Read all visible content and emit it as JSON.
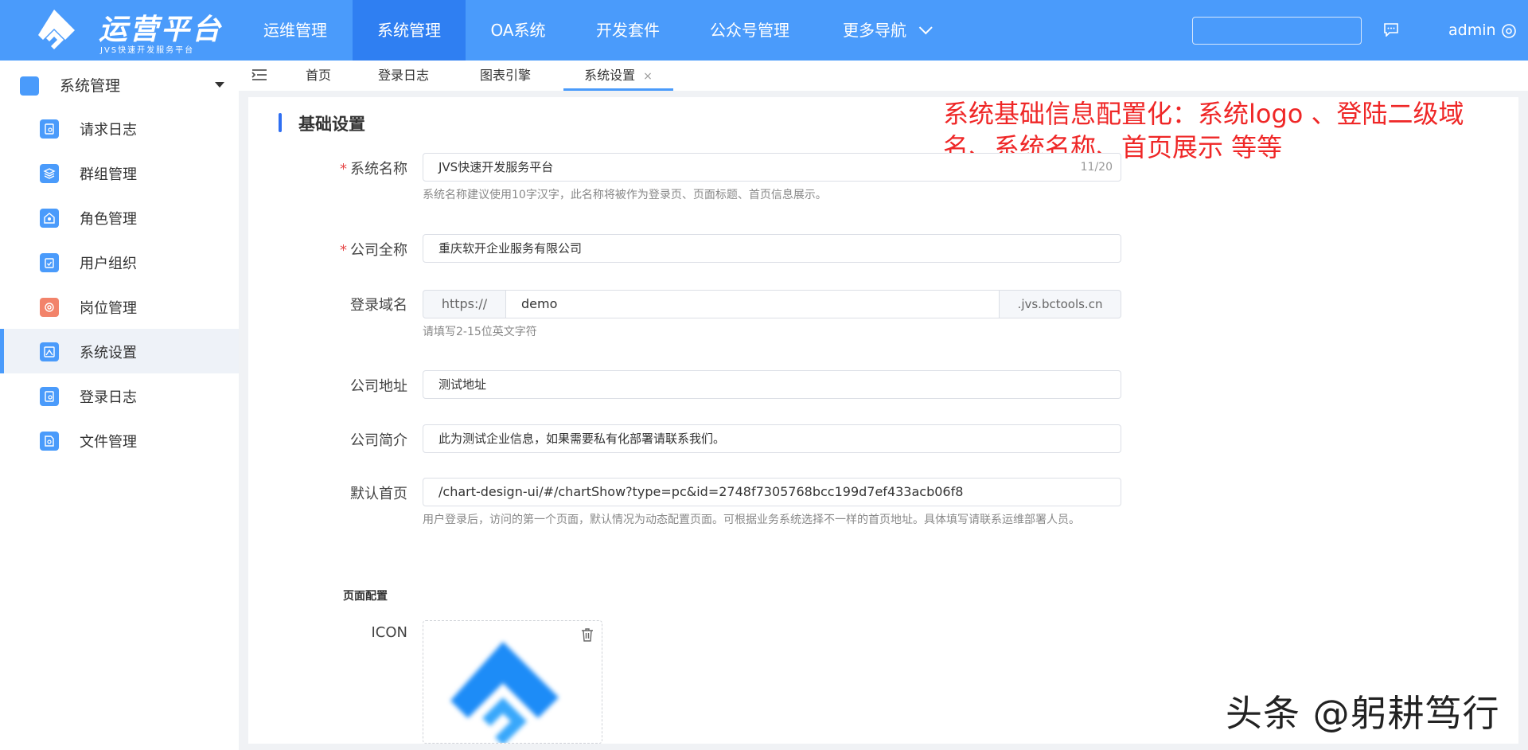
{
  "header": {
    "logo_title": "运营平台",
    "logo_subtitle": "JVS快速开发服务平台",
    "nav": [
      {
        "label": "运维管理"
      },
      {
        "label": "系统管理"
      },
      {
        "label": "OA系统"
      },
      {
        "label": "开发套件"
      },
      {
        "label": "公众号管理"
      },
      {
        "label": "更多导航"
      }
    ],
    "search_value": "",
    "user_name": "admin"
  },
  "sidebar": {
    "header_label": "系统管理",
    "items": [
      {
        "label": "请求日志",
        "icon": "request-log-icon"
      },
      {
        "label": "群组管理",
        "icon": "group-icon"
      },
      {
        "label": "角色管理",
        "icon": "role-icon"
      },
      {
        "label": "用户组织",
        "icon": "user-org-icon"
      },
      {
        "label": "岗位管理",
        "icon": "position-icon"
      },
      {
        "label": "系统设置",
        "icon": "system-settings-icon"
      },
      {
        "label": "登录日志",
        "icon": "login-log-icon"
      },
      {
        "label": "文件管理",
        "icon": "file-icon"
      }
    ],
    "active_index": 5
  },
  "tabs": {
    "items": [
      {
        "label": "首页"
      },
      {
        "label": "登录日志"
      },
      {
        "label": "图表引擎"
      },
      {
        "label": "系统设置",
        "closable": "×"
      }
    ],
    "active_index": 3
  },
  "form": {
    "section_title": "基础设置",
    "annotation": "系统基础信息配置化：系统logo 、登陆二级域名、系统名称、首页展示  等等",
    "fields": {
      "system_name": {
        "label": "系统名称",
        "required": "*",
        "value": "JVS快速开发服务平台",
        "counter": "11/20",
        "hint": "系统名称建议使用10字汉字，此名称将被作为登录页、页面标题、首页信息展示。"
      },
      "company_name": {
        "label": "公司全称",
        "required": "*",
        "value": "重庆软开企业服务有限公司"
      },
      "domain": {
        "label": "登录域名",
        "prefix": "https://",
        "value": "demo",
        "suffix": ".jvs.bctools.cn",
        "hint": "请填写2-15位英文字符"
      },
      "address": {
        "label": "公司地址",
        "value": "测试地址"
      },
      "intro": {
        "label": "公司简介",
        "value": "此为测试企业信息，如果需要私有化部署请联系我们。"
      },
      "homepage": {
        "label": "默认首页",
        "value": "/chart-design-ui/#/chartShow?type=pc&id=2748f7305768bcc199d7ef433acb06f8",
        "hint": "用户登录后，访问的第一个页面，默认情况为动态配置页面。可根据业务系统选择不一样的首页地址。具体填写请联系运维部署人员。"
      }
    },
    "page_config_title": "页面配置",
    "icon_label": "ICON"
  },
  "watermark": "头条 @躬耕笃行",
  "colors": {
    "primary": "#4a9bfb",
    "nav_active": "#2f7ff2",
    "annotation": "#ef2727",
    "required": "#e64a4a"
  }
}
